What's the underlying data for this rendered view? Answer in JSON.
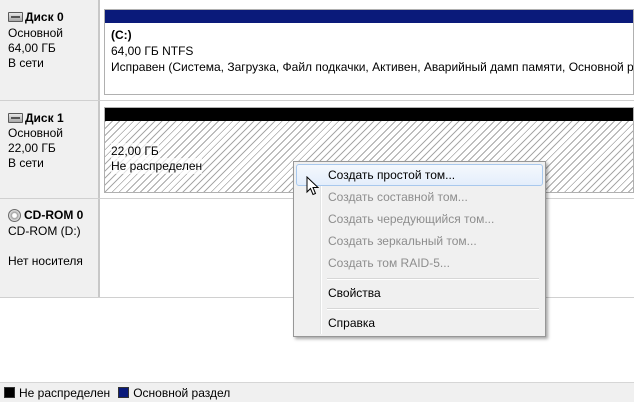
{
  "disks": [
    {
      "name": "Диск 0",
      "type": "Основной",
      "size": "64,00 ГБ",
      "status": "В сети",
      "volume": {
        "letter": "(C:)",
        "size_fs": "64,00 ГБ NTFS",
        "status": "Исправен (Система, Загрузка, Файл подкачки, Активен, Аварийный дамп памяти, Основной раздел)"
      }
    },
    {
      "name": "Диск 1",
      "type": "Основной",
      "size": "22,00 ГБ",
      "status": "В сети",
      "volume": {
        "size": "22,00 ГБ",
        "status": "Не распределен"
      }
    }
  ],
  "cdrom": {
    "name": "CD-ROM 0",
    "drive": "CD-ROM (D:)",
    "status": "Нет носителя"
  },
  "context_menu": {
    "items": [
      {
        "label": "Создать простой том...",
        "enabled": true,
        "highlighted": true
      },
      {
        "label": "Создать составной том...",
        "enabled": false
      },
      {
        "label": "Создать чередующийся том...",
        "enabled": false
      },
      {
        "label": "Создать зеркальный том...",
        "enabled": false
      },
      {
        "label": "Создать том RAID-5...",
        "enabled": false
      },
      {
        "label": "Свойства",
        "enabled": true
      },
      {
        "label": "Справка",
        "enabled": true
      }
    ]
  },
  "legend": {
    "unallocated": {
      "label": "Не распределен",
      "color": "#000000"
    },
    "primary": {
      "label": "Основной раздел",
      "color": "#0a1a7a"
    }
  },
  "colors": {
    "primary_bar": "#0a1a7a",
    "unallocated_bar": "#000000",
    "menu_highlight_border": "#a8c8ed"
  }
}
